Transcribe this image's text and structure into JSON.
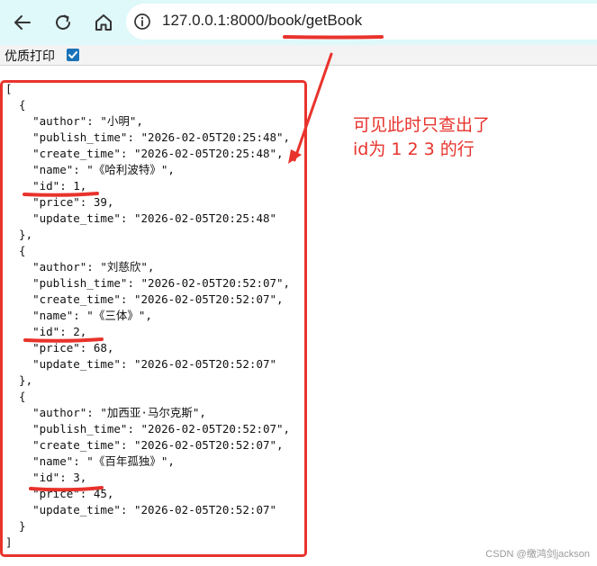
{
  "browser": {
    "url": "127.0.0.1:8000/book/getBook"
  },
  "print_option": {
    "label": "优质打印",
    "checked": true
  },
  "json_lines": [
    "[",
    "  {",
    "    \"author\": \"小明\",",
    "    \"publish_time\": \"2026-02-05T20:25:48\",",
    "    \"create_time\": \"2026-02-05T20:25:48\",",
    "    \"name\": \"《哈利波特》\",",
    "    \"id\": 1,",
    "    \"price\": 39,",
    "    \"update_time\": \"2026-02-05T20:25:48\"",
    "  },",
    "  {",
    "    \"author\": \"刘慈欣\",",
    "    \"publish_time\": \"2026-02-05T20:52:07\",",
    "    \"create_time\": \"2026-02-05T20:52:07\",",
    "    \"name\": \"《三体》\",",
    "    \"id\": 2,",
    "    \"price\": 68,",
    "    \"update_time\": \"2026-02-05T20:52:07\"",
    "  },",
    "  {",
    "    \"author\": \"加西亚·马尔克斯\",",
    "    \"publish_time\": \"2026-02-05T20:52:07\",",
    "    \"create_time\": \"2026-02-05T20:52:07\",",
    "    \"name\": \"《百年孤独》\",",
    "    \"id\": 3,",
    "    \"price\": 45,",
    "    \"update_time\": \"2026-02-05T20:52:07\"",
    "  }",
    "]"
  ],
  "annotation": {
    "text": "可见此时只查出了\nid为 1 2 3 的行",
    "color": "#e8332c"
  },
  "watermark": "CSDN @缴鸿剑jackson",
  "colors": {
    "toolbar_bg": "#dff8fa",
    "annotation_red": "#e8332c",
    "checkbox_blue": "#1a73b8"
  },
  "icons": [
    "back-arrow-icon",
    "reload-icon",
    "home-icon",
    "info-icon",
    "checkmark-icon"
  ]
}
